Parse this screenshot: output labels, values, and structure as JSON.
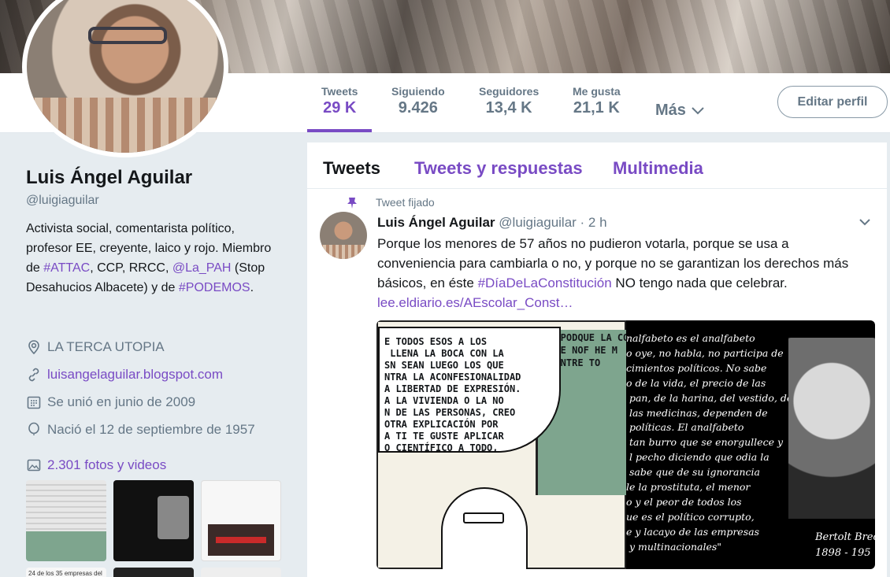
{
  "profile": {
    "name": "Luis Ángel Aguilar",
    "handle": "@luigiaguilar",
    "bio": {
      "p1": "Activista social, comentarista político, profesor EE, creyente, laico y rojo. Miembro de ",
      "attac": "#ATTAC",
      "p2": ", CCP, RRCC, ",
      "pah": "@La_PAH",
      "p3": " (Stop Desahucios Albacete) y de ",
      "podemos": "#PODEMOS",
      "p4": "."
    },
    "location": "LA TERCA UTOPIA",
    "website": "luisangelaguilar.blogspot.com",
    "joined": "Se unió en junio de 2009",
    "born": "Nació el 12 de septiembre de 1957",
    "photos_label": "2.301 fotos y videos",
    "thumb_4_text": "24 de los 35 empresas del"
  },
  "stats": {
    "tweets": {
      "label": "Tweets",
      "value": "29 K"
    },
    "following": {
      "label": "Siguiendo",
      "value": "9.426"
    },
    "followers": {
      "label": "Seguidores",
      "value": "13,4 K"
    },
    "likes": {
      "label": "Me gusta",
      "value": "21,1 K"
    },
    "more": "Más"
  },
  "edit_profile": "Editar perfil",
  "tabs": [
    "Tweets",
    "Tweets y respuestas",
    "Multimedia"
  ],
  "tweet": {
    "pinned_label": "Tweet fijado",
    "author": "Luis Ángel Aguilar",
    "handle_time": "@luigiaguilar · 2 h",
    "text": "Porque los menores de 57 años no pudieron votarla, porque se usa a conveniencia para cambiarla o no, y porque no se garantizan los derechos más básicos, en éste ",
    "hashtag": "#DíaDeLaConstitución",
    "text_end": " NO tengo nada que celebrar.",
    "link": "lee.eldiario.es/AEscolar_Const…"
  },
  "media": {
    "cartoon_bubble": "E TODOS ESOS A LOS\n LLENA LA BOCA CON LA\nSN SEAN LUEGO LOS QUE\nNTRA LA ACONFESIONALIDAD\nA LIBERTAD DE EXPRESIÓN.\nA LA VIVIENDA O LA NO\nN DE LAS PERSONAS, CREO\nOTRA EXPLICACIÓN POR\nA TI TE GUSTE APLICAR\nO CIENTÍFICO A TODO,\nNTONIO JOSÉ.",
    "cartoon_board": "...PODQUE LA CON\n QUE NOF HE M\n  ENTRE TO",
    "quote_text": "nalfabeto es el analfabeto\no oye, no habla, no participa de\ncimientos políticos. No sabe\no de la vida, el precio de las\n pan, de la harina, del vestido, del\n las medicinas, dependen de\n políticas. El analfabeto\n tan burro que se enorgullece y\n l pecho diciendo que odia la\n sabe que de su ignorancia\nle la prostituta, el menor\no y el peor de todos los\nue es el político corrupto,\ne y lacayo de las empresas\n y multinacionales\"",
    "quote_sig": "Bertolt Brec\n1898 - 195"
  },
  "colors": {
    "accent": "#794bc4",
    "muted": "#657786",
    "text": "#14171a",
    "background": "#e6ecf0"
  }
}
